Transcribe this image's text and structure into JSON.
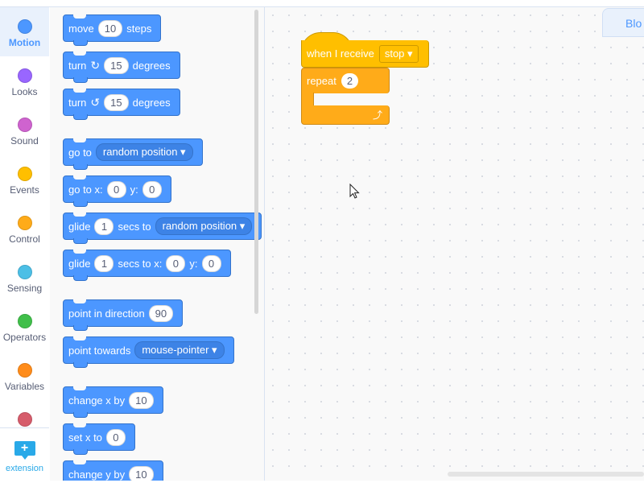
{
  "categories": [
    {
      "label": "Motion",
      "color": "#4c97ff",
      "selected": true
    },
    {
      "label": "Looks",
      "color": "#9966ff"
    },
    {
      "label": "Sound",
      "color": "#cf63cf"
    },
    {
      "label": "Events",
      "color": "#ffbf00"
    },
    {
      "label": "Control",
      "color": "#ffab19"
    },
    {
      "label": "Sensing",
      "color": "#4cbfe6"
    },
    {
      "label": "Operators",
      "color": "#40bf4a"
    },
    {
      "label": "Variables",
      "color": "#ff8c1a"
    },
    {
      "label": "",
      "color": "#d65c6b"
    }
  ],
  "extension": {
    "label": "extension",
    "icon": "add-extension-icon"
  },
  "palette": {
    "move": {
      "pre": "move",
      "val": "10",
      "post": "steps"
    },
    "turn_right": {
      "pre": "turn",
      "icon": "rotate-right-icon",
      "val": "15",
      "post": "degrees"
    },
    "turn_left": {
      "pre": "turn",
      "icon": "rotate-left-icon",
      "val": "15",
      "post": "degrees"
    },
    "goto": {
      "pre": "go to",
      "option": "random position"
    },
    "goto_xy": {
      "pre": "go to x:",
      "x": "0",
      "mid": "y:",
      "y": "0"
    },
    "glide_to": {
      "pre": "glide",
      "val": "1",
      "mid": "secs to",
      "option": "random position"
    },
    "glide_xy": {
      "pre": "glide",
      "val": "1",
      "mid": "secs to x:",
      "x": "0",
      "ylabel": "y:",
      "y": "0"
    },
    "point_dir": {
      "pre": "point in direction",
      "val": "90"
    },
    "point_towards": {
      "pre": "point towards",
      "option": "mouse-pointer"
    },
    "change_x": {
      "pre": "change x by",
      "val": "10"
    },
    "set_x": {
      "pre": "set x to",
      "val": "0"
    },
    "change_y": {
      "pre": "change y by",
      "val": "10"
    }
  },
  "workspace": {
    "tab_label": "Blo",
    "when_receive": {
      "label": "when I receive",
      "option": "stop"
    },
    "repeat": {
      "label": "repeat",
      "val": "2"
    }
  },
  "colors": {
    "motion": "#4c97ff",
    "events": "#ffbf00",
    "control": "#ffab19"
  }
}
